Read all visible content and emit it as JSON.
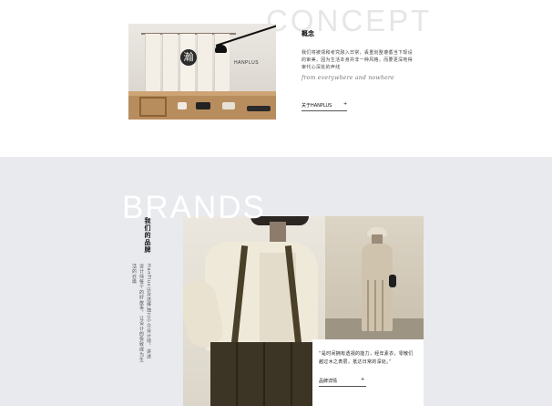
{
  "concept": {
    "watermark": "CONCEPT",
    "heading": "概念",
    "body": "我们将被领和考究融入日常，丢重划整遵循当下现设的审美，因为生活本身并非一种风格，而要更深地得审代心深处的声线",
    "script_line": "from everywhere and nowhere",
    "link_label": "关于HANPLUS",
    "link_arrow": "+",
    "photo": {
      "seal_char": "瀚",
      "sign_text": "HANPLUS"
    }
  },
  "brands": {
    "watermark": "BRANDS",
    "heading": "我们的品牌",
    "body": "HanPlus以及选择独立小众设计师，讲述设计师每个的好故事，让设计的极致成为生活的召唤",
    "quote": "“是时间拥有透视的能力，经年素衣，零散们越过木之表层，抵达日常的深处。”",
    "link_label": "品牌详情",
    "link_arrow": "+"
  },
  "colors": {
    "brands_bg": "#e8eaed",
    "concept_watermark": "#e6e6e6",
    "brands_watermark": "#ffffff"
  }
}
